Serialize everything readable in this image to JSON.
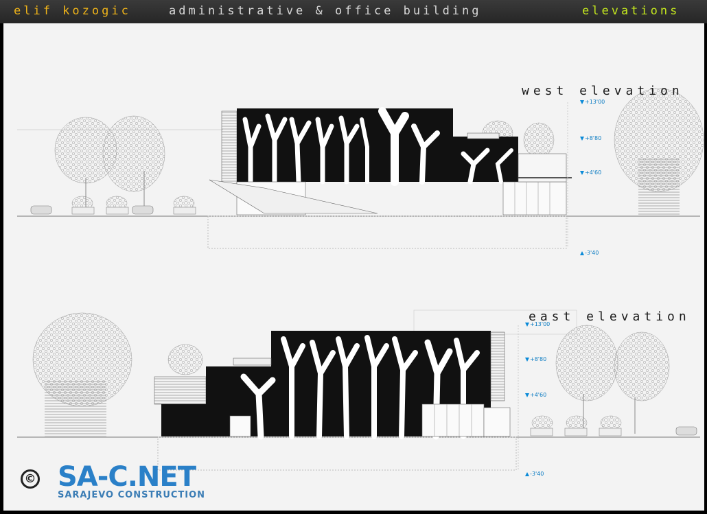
{
  "header": {
    "author": "elif kozogic",
    "title": "administrative & office building",
    "section": "elevations"
  },
  "west": {
    "label": "west elevation",
    "levels": [
      "+13'00",
      "+8'80",
      "+4'60",
      "-3'40"
    ]
  },
  "east": {
    "label": "east elevation",
    "levels": [
      "+13'00",
      "+8'80",
      "+4'60",
      "-3'40"
    ]
  },
  "logo": {
    "symbol": "©",
    "name": "SA-C.NET",
    "subtitle": "SARAJEVO CONSTRUCTION"
  },
  "colors": {
    "author": "#f0b419",
    "section": "#c3e61e",
    "level_marker": "#0a8ad8",
    "logo": "#2a80c8"
  }
}
